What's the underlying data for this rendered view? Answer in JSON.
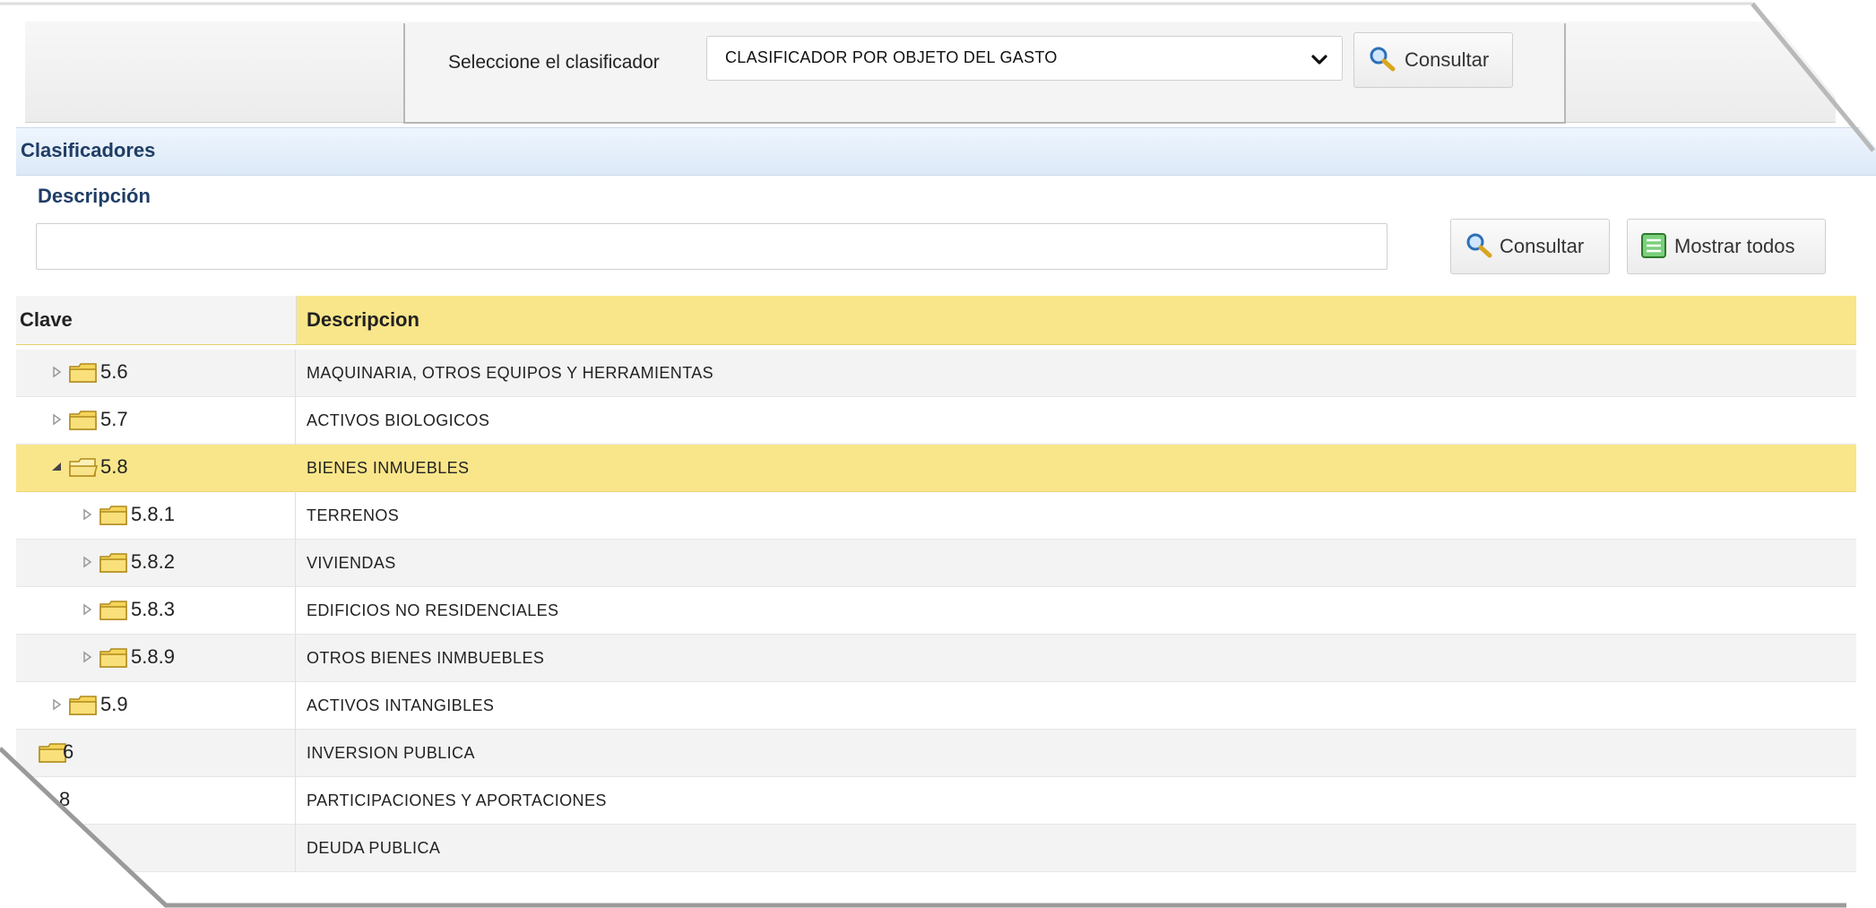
{
  "filter": {
    "label": "Seleccione el clasificador",
    "selected": "CLASIFICADOR POR OBJETO DEL GASTO",
    "consult_label": "Consultar"
  },
  "section": {
    "title": "Clasificadores"
  },
  "search": {
    "label": "Descripción",
    "value": "",
    "consult_label": "Consultar",
    "show_all_label": "Mostrar todos"
  },
  "grid": {
    "columns": {
      "clave": "Clave",
      "descripcion": "Descripcion"
    },
    "rows": [
      {
        "clave": "5.6",
        "descripcion": "MAQUINARIA, OTROS EQUIPOS Y HERRAMIENTAS",
        "level": 1,
        "expanded": false,
        "selected": false
      },
      {
        "clave": "5.7",
        "descripcion": "ACTIVOS BIOLOGICOS",
        "level": 1,
        "expanded": false,
        "selected": false
      },
      {
        "clave": "5.8",
        "descripcion": "BIENES INMUEBLES",
        "level": 1,
        "expanded": true,
        "selected": true
      },
      {
        "clave": "5.8.1",
        "descripcion": "TERRENOS",
        "level": 2,
        "expanded": false,
        "selected": false
      },
      {
        "clave": "5.8.2",
        "descripcion": "VIVIENDAS",
        "level": 2,
        "expanded": false,
        "selected": false
      },
      {
        "clave": "5.8.3",
        "descripcion": "EDIFICIOS NO RESIDENCIALES",
        "level": 2,
        "expanded": false,
        "selected": false
      },
      {
        "clave": "5.8.9",
        "descripcion": "OTROS BIENES INMBUEBLES",
        "level": 2,
        "expanded": false,
        "selected": false
      },
      {
        "clave": "5.9",
        "descripcion": "ACTIVOS INTANGIBLES",
        "level": 1,
        "expanded": false,
        "selected": false
      },
      {
        "clave": "6",
        "descripcion": "INVERSION PUBLICA",
        "level": 0,
        "expanded": false,
        "selected": false
      },
      {
        "clave": "8",
        "descripcion": "PARTICIPACIONES Y APORTACIONES",
        "level": 0,
        "expanded": false,
        "selected": false
      },
      {
        "clave": "",
        "descripcion": "DEUDA PUBLICA",
        "level": 0,
        "expanded": false,
        "selected": false
      }
    ]
  },
  "colors": {
    "selected_row": "#f9e68a",
    "header_text": "#1f3d66",
    "folder": "#f5d55a"
  }
}
